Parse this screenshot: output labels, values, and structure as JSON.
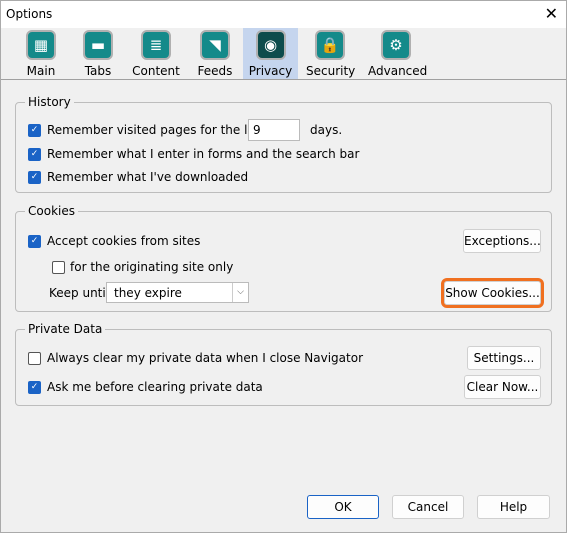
{
  "window": {
    "title": "Options",
    "close_icon": "close-icon"
  },
  "tabs": [
    {
      "label": "Main",
      "icon": "main-grid-icon",
      "glyph": "▦"
    },
    {
      "label": "Tabs",
      "icon": "tabs-icon",
      "glyph": "▬"
    },
    {
      "label": "Content",
      "icon": "content-stack-icon",
      "glyph": "≣"
    },
    {
      "label": "Feeds",
      "icon": "rss-feed-icon",
      "glyph": "◥"
    },
    {
      "label": "Privacy",
      "icon": "eye-icon",
      "glyph": "◉",
      "selected": true
    },
    {
      "label": "Security",
      "icon": "lock-icon",
      "glyph": "🔒"
    },
    {
      "label": "Advanced",
      "icon": "gear-icon",
      "glyph": "⚙"
    }
  ],
  "history": {
    "title": "History",
    "visited_label": "Remember visited pages for the last",
    "visited_checked": true,
    "days_value": "9",
    "days_label": "days.",
    "forms_label": "Remember what I enter in forms and the search bar",
    "forms_checked": true,
    "downloads_label": "Remember what I've downloaded",
    "downloads_checked": true
  },
  "cookies": {
    "title": "Cookies",
    "accept_label": "Accept cookies from sites",
    "accept_checked": true,
    "origin_label": "for the originating site only",
    "origin_checked": false,
    "keep_until_label": "Keep until:",
    "keep_until_value": "they expire",
    "exceptions_button": "Exceptions...",
    "show_cookies_button": "Show Cookies..."
  },
  "private_data": {
    "title": "Private Data",
    "always_clear_label": "Always clear my private data when I close Navigator",
    "always_clear_checked": false,
    "ask_label": "Ask me before clearing private data",
    "ask_checked": true,
    "settings_button": "Settings...",
    "clear_now_button": "Clear Now..."
  },
  "footer": {
    "ok": "OK",
    "cancel": "Cancel",
    "help": "Help"
  },
  "colors": {
    "accent": "#1a63c6",
    "highlight": "#f07020",
    "selected_tab": "#c5d5ee"
  }
}
